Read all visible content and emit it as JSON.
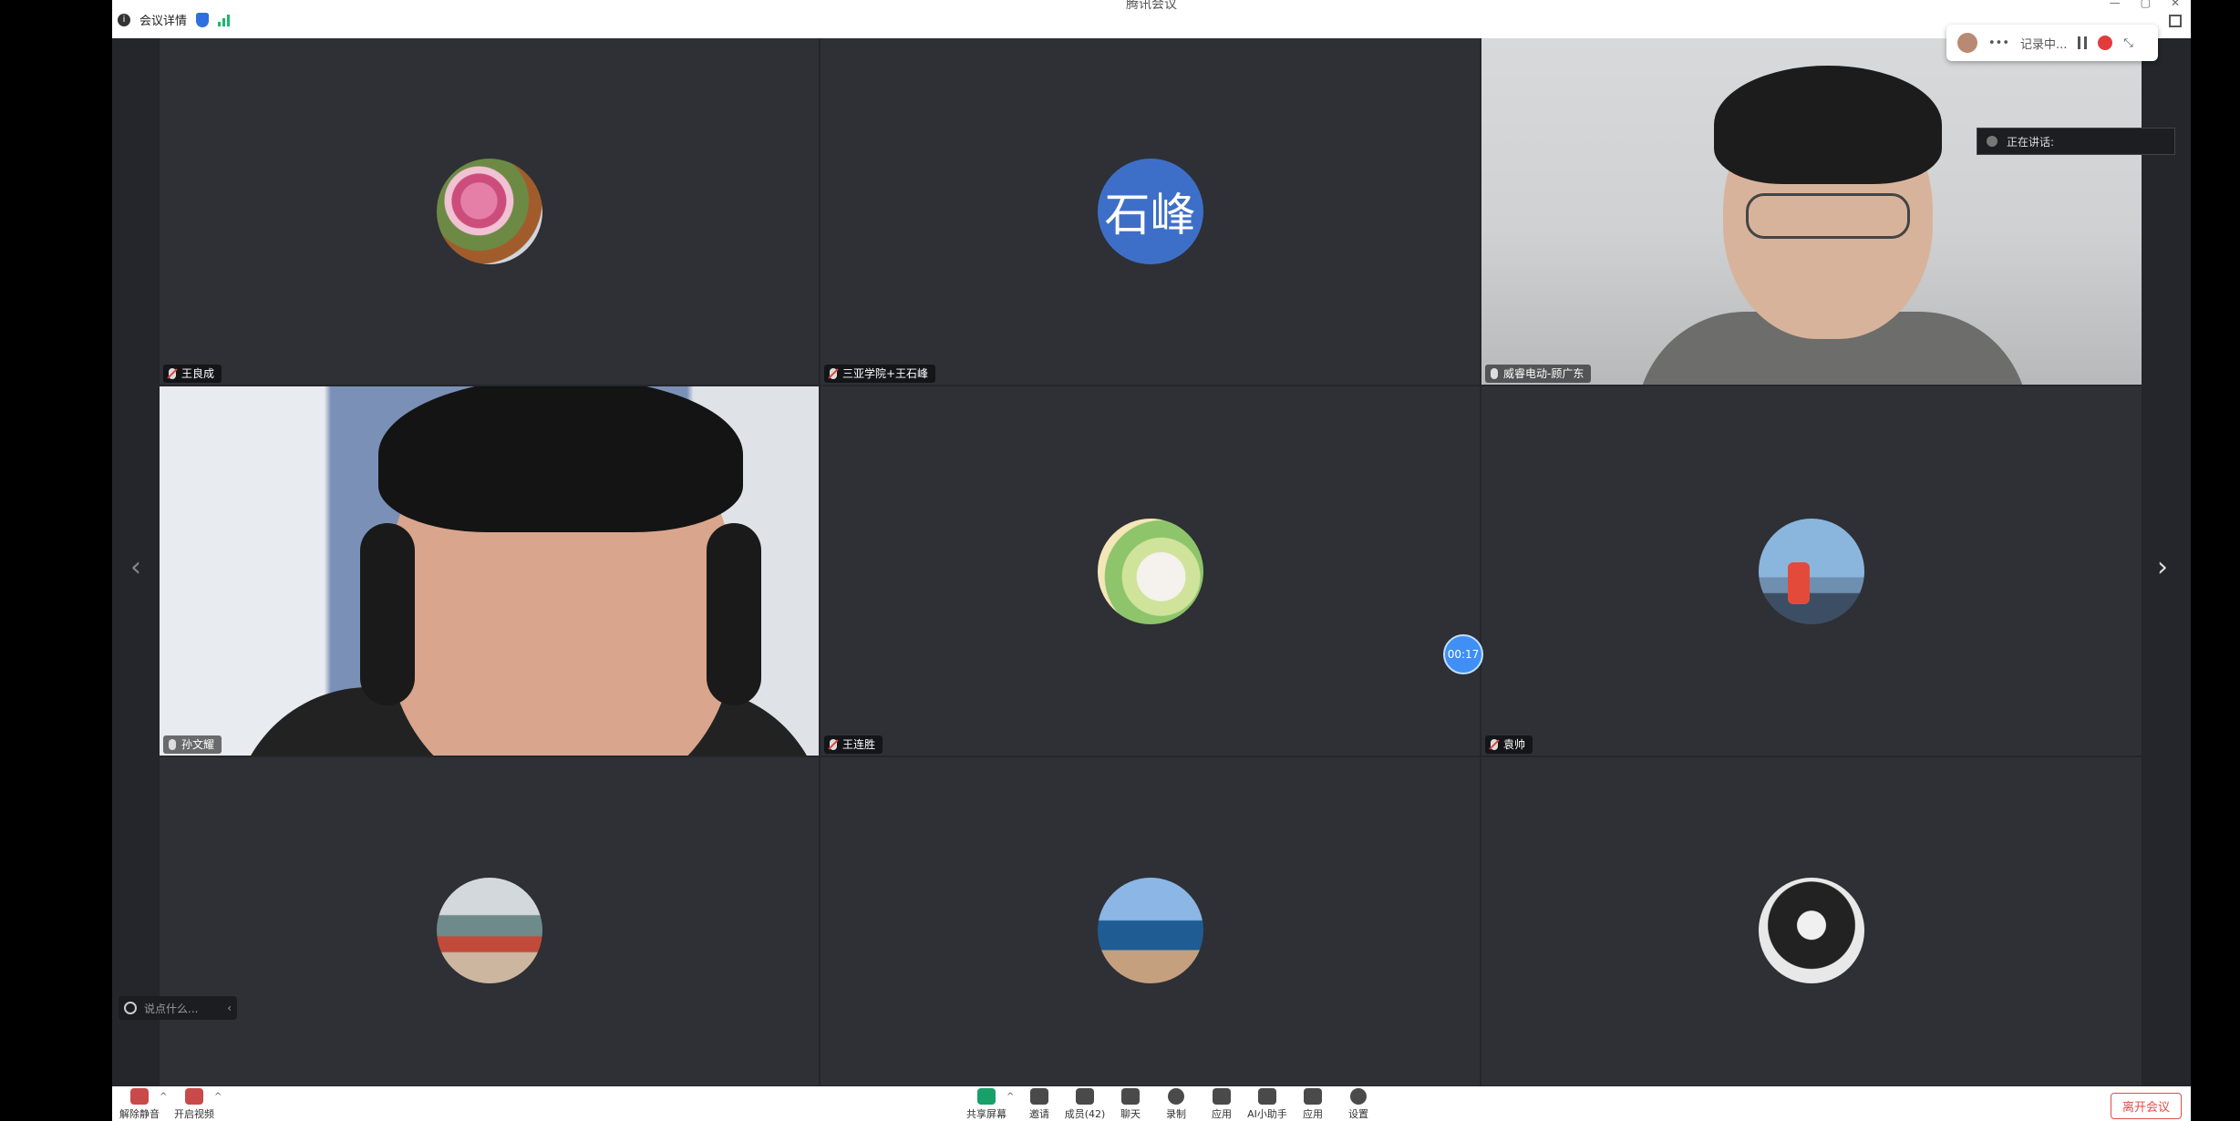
{
  "window": {
    "title": "腾讯会议"
  },
  "titlebar": {
    "meeting_info": "会议详情"
  },
  "participants": [
    {
      "name": "王良成",
      "avatar_text": "",
      "mic": "muted"
    },
    {
      "name": "三亚学院+王石峰",
      "avatar_text": "石峰",
      "mic": "muted"
    },
    {
      "name": "威睿电动-顾广东",
      "avatar_text": "",
      "mic": "on"
    },
    {
      "name": "孙文耀",
      "avatar_text": "",
      "mic": "on"
    },
    {
      "name": "王连胜",
      "avatar_text": "",
      "mic": "muted"
    },
    {
      "name": "袁帅",
      "avatar_text": "",
      "mic": "muted"
    },
    {
      "name": "",
      "avatar_text": "",
      "mic": ""
    },
    {
      "name": "",
      "avatar_text": "",
      "mic": ""
    },
    {
      "name": "",
      "avatar_text": "",
      "mic": ""
    }
  ],
  "recording": {
    "status": "记录中..."
  },
  "speaking": {
    "label": "正在讲话:"
  },
  "timer": {
    "value": "00:17"
  },
  "chat": {
    "placeholder": "说点什么..."
  },
  "toolbar": {
    "left": [
      {
        "label": "解除静音"
      },
      {
        "label": "开启视频"
      }
    ],
    "center": [
      {
        "label": "共享屏幕"
      },
      {
        "label": "邀请"
      },
      {
        "label": "成员(42)"
      },
      {
        "label": "聊天"
      },
      {
        "label": "录制"
      },
      {
        "label": "应用"
      },
      {
        "label": "AI小助手"
      },
      {
        "label": "应用"
      },
      {
        "label": "设置"
      }
    ],
    "leave_label": "离开会议"
  }
}
